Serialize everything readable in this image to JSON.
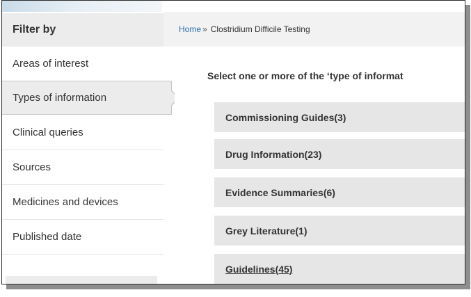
{
  "sidebar": {
    "header": "Filter by",
    "items": [
      {
        "label": "Areas of interest"
      },
      {
        "label": "Types of information"
      },
      {
        "label": "Clinical queries"
      },
      {
        "label": "Sources"
      },
      {
        "label": "Medicines and devices"
      },
      {
        "label": "Published date"
      }
    ],
    "active_index": 1
  },
  "breadcrumb": {
    "home": "Home",
    "separator": "»",
    "current": "Clostridium Difficile Testing"
  },
  "main": {
    "prompt": "Select one or more of the ‘type of informat",
    "types": [
      {
        "label": "Commissioning Guides(3)"
      },
      {
        "label": "Drug Information(23)"
      },
      {
        "label": "Evidence Summaries(6)"
      },
      {
        "label": "Grey Literature(1)"
      },
      {
        "label": "Guidelines(45)"
      }
    ]
  },
  "colors": {
    "link": "#2a6fa8",
    "panel_grey": "#ececec",
    "item_grey": "#e6e6e6"
  }
}
